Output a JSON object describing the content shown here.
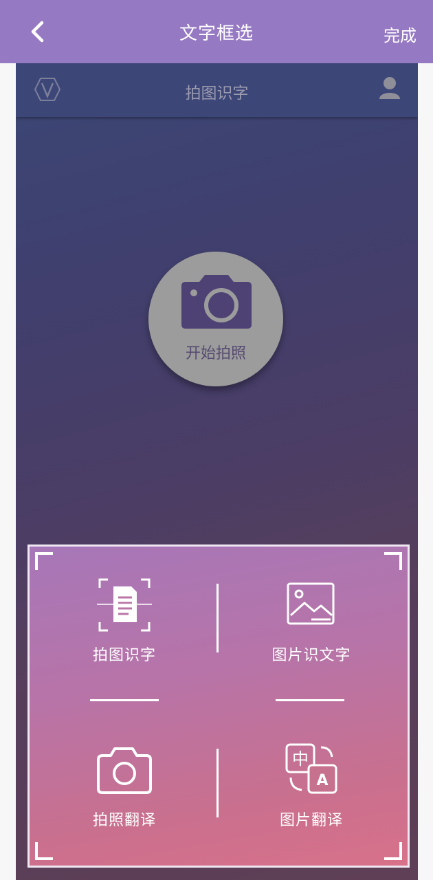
{
  "topbar": {
    "title": "文字框选",
    "done_label": "完成"
  },
  "card": {
    "title": "拍图识字",
    "shoot_label": "开始拍照"
  },
  "features": [
    {
      "label": "拍图识字",
      "icon": "document-scan-icon"
    },
    {
      "label": "图片识文字",
      "icon": "image-icon"
    },
    {
      "label": "拍照翻译",
      "icon": "camera-icon"
    },
    {
      "label": "图片翻译",
      "icon": "translate-icon"
    }
  ],
  "colors": {
    "topbar": "#9679c3",
    "card_header": "#3c4677",
    "shoot_button": "#9d9c9c",
    "panel_top": "#a777b8",
    "panel_bottom": "#d8718a"
  }
}
